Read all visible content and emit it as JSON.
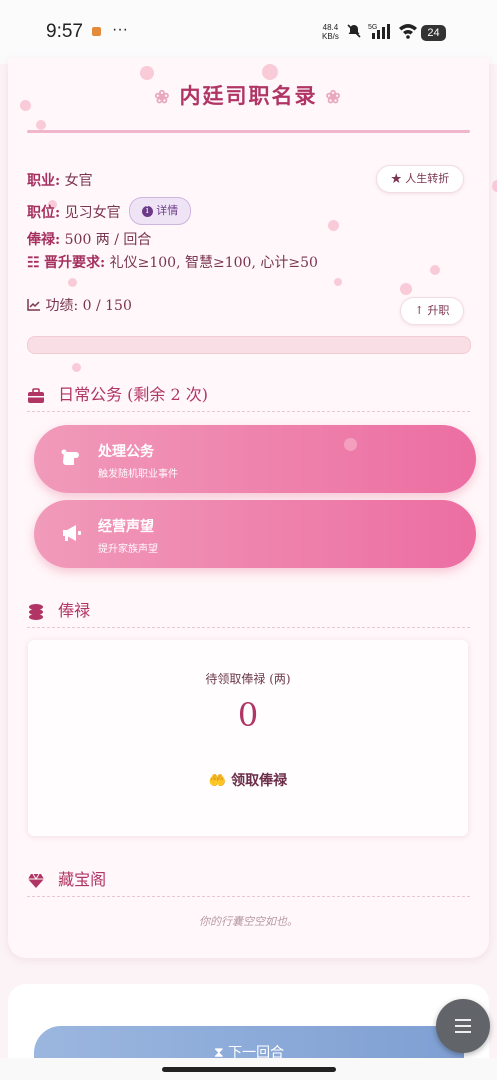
{
  "status_bar": {
    "time": "9:57",
    "more": "···",
    "net_speed": "48.4",
    "net_unit": "KB/s",
    "signal_label": "5G",
    "battery": "24"
  },
  "header": {
    "title": "内廷司职名录"
  },
  "info": {
    "job_label": "职业:",
    "job_value": "女官",
    "life_turn_button": "人生转折",
    "position_label": "职位:",
    "position_value": "见习女官",
    "detail_button": "详情",
    "salary_label": "俸禄:",
    "salary_value": "500 两 / 回合",
    "promo_label": "晋升要求:",
    "promo_value": "礼仪≥100, 智慧≥100, 心计≥50",
    "merit_label": "功绩:",
    "merit_value": "0 / 150",
    "promote_button": "升职",
    "merit_progress": 0.0
  },
  "daily_affairs": {
    "title": "日常公务 (剩余 2 次)",
    "actions": [
      {
        "title": "处理公务",
        "subtitle": "触发随机职业事件"
      },
      {
        "title": "经营声望",
        "subtitle": "提升家族声望"
      }
    ]
  },
  "salary": {
    "title": "俸禄",
    "pending_label": "待领取俸禄 (两)",
    "pending_value": "0",
    "claim_button": "领取俸禄"
  },
  "treasury": {
    "title": "藏宝阁",
    "empty_text": "你的行囊空空如也。"
  },
  "footer": {
    "next_turn_button": "下一回合"
  },
  "colors": {
    "accent": "#b03565",
    "action_gradient_start": "#f19ab9",
    "action_gradient_end": "#ec6ea2",
    "next_button": "#8fabd9"
  }
}
